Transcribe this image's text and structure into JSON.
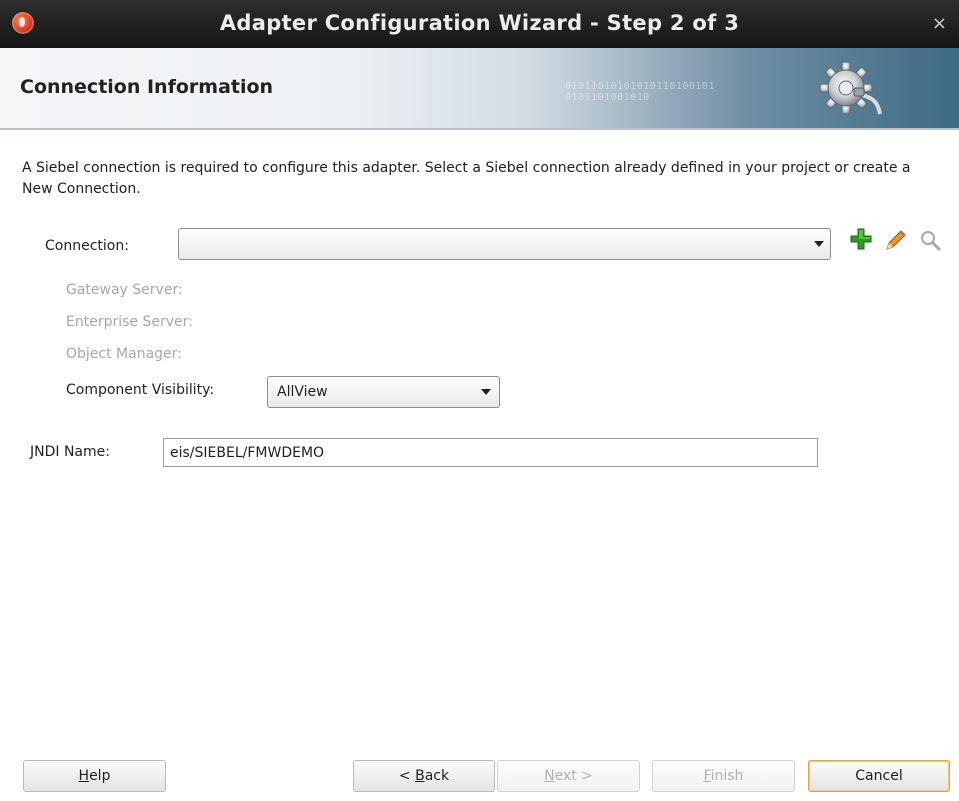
{
  "window": {
    "title": "Adapter Configuration Wizard - Step 2 of 3",
    "close_glyph": "×"
  },
  "header": {
    "title": "Connection Information",
    "binary_text": "01011010101010110100101 0101101001010",
    "icon": "gear-plug-icon"
  },
  "description": "A Siebel connection is required to configure this adapter. Select a Siebel connection already defined in your project or create a New Connection.",
  "connection": {
    "label": "Connection:",
    "value": "",
    "actions": {
      "add_icon": "plus-icon",
      "edit_icon": "pencil-icon",
      "search_icon": "magnifier-icon"
    }
  },
  "details": {
    "gateway_server": "Gateway Server:",
    "enterprise_server": "Enterprise Server:",
    "object_manager": "Object Manager:"
  },
  "component_visibility": {
    "label": "Component Visibility:",
    "value": "AllView"
  },
  "jndi": {
    "label": "JNDI Name:",
    "value": "eis/SIEBEL/FMWDEMO"
  },
  "buttons": {
    "help": {
      "mnemonic": "H",
      "rest": "elp"
    },
    "back": {
      "prefix": "< ",
      "mnemonic": "B",
      "rest": "ack"
    },
    "next": {
      "mnemonic": "N",
      "rest": "ext >"
    },
    "finish": {
      "mnemonic": "F",
      "rest": "inish"
    },
    "cancel": {
      "label": "Cancel"
    }
  },
  "colors": {
    "titlebar": "#1e1e1e",
    "add_icon_green": "#2e9a1f",
    "default_button_border": "#e2a243"
  }
}
